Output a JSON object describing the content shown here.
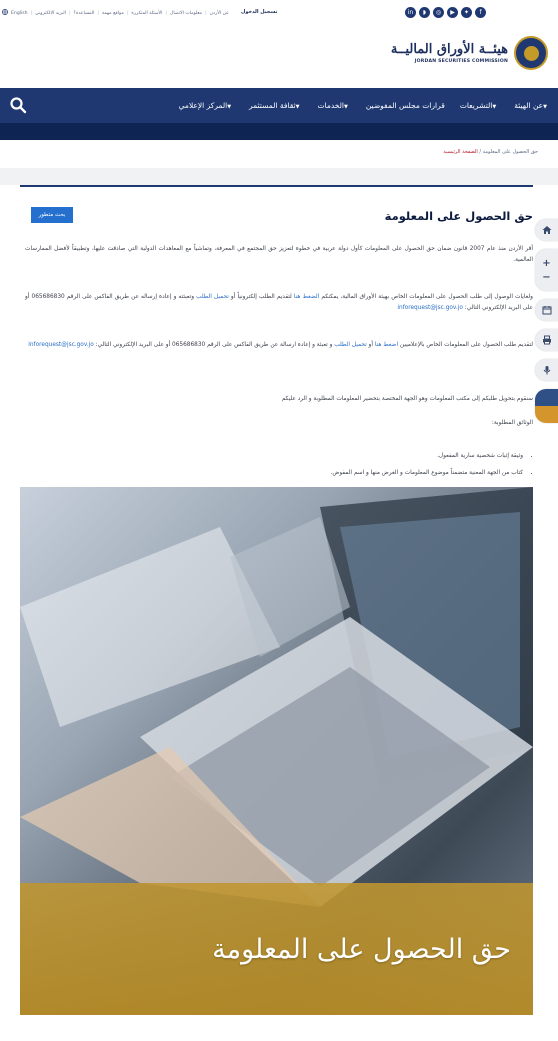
{
  "top_bar": {
    "links": [
      "English",
      "البريد الالكتروني",
      "المساعدة؟",
      "مواقع مهمة",
      "الأسئلة المتكررة",
      "معلومات الاتصال",
      "عن الأردن"
    ],
    "login": "تسجيل الدخول",
    "social_icons": [
      "linkedin-icon",
      "rss-icon",
      "instagram-icon",
      "youtube-icon",
      "twitter-icon",
      "facebook-icon"
    ]
  },
  "logo": {
    "arabic": "هيئــة الأوراق الماليــة",
    "english": "JORDAN SECURITIES COMMISSION"
  },
  "nav": {
    "items": [
      {
        "label": "عن الهيئة",
        "dropdown": true
      },
      {
        "label": "التشريعات",
        "dropdown": true
      },
      {
        "label": "قرارات مجلس المفوضين",
        "dropdown": false
      },
      {
        "label": "الخدمات",
        "dropdown": true
      },
      {
        "label": "ثقافة المستثمر",
        "dropdown": true
      },
      {
        "label": "المركز الإعلامي",
        "dropdown": true
      }
    ]
  },
  "breadcrumb": {
    "home": "الصفحة الرئيسية",
    "separator": "/",
    "current": "حق الحصول على المعلومة"
  },
  "page": {
    "title": "حق الحصول على المعلومة",
    "update_button": "بحث متطور",
    "p1": "أقر الأردن منذ عام 2007 قانون ضمان حق الحصول على المعلومات كأول دولة عربية في خطوة لتعزيز حق المجتمع في المعرفة، وتماشياً مع المعاهدات الدولية التي صادقت عليها، وتطبيقاً لأفضل الممارسات العالمية.",
    "p2_a": "ولغايات الوصول إلى طلب الحصول على المعلومات الخاص بهيئة الأوراق المالية، يمكنكم ",
    "p2_link1": "الضغط هنا",
    "p2_b": " لتقديم الطلب إلكترونياً أو ",
    "p2_link2": "تحميل الطلب",
    "p2_c": " وتعبئته و إعادة إرساله عن طريق الفاكس على الرقم 065686830 أو على البريد الإلكتروني التالي: ",
    "p2_email": "inforequest@jsc.gov.jo",
    "p3_a": "لتقديم طلب الحصول على المعلومات الخاص بالإعلاميين ",
    "p3_link1": "اضغط هنا",
    "p3_b": " أو ",
    "p3_link2": "تحميل الطلب",
    "p3_c": " و تعبئة و إعادة ارسالة عن طريق الفاكس على الرقم 065686830 أو على البريد الإلكتروني التالي: ",
    "p3_email": "inforequest@jsc.gov.jo",
    "p4": "سنقوم بتحويل طلبكم إلى مكتب المعلومات وهو الجهة المختصة بتحضير المعلومات المطلوبة و الرد عليكم",
    "documents_heading": "الوثائق المطلوبة:",
    "documents": [
      "وثيقة إثبات شخصية سارية المفعول.",
      "كتاب من الجهة المعنية متضمناً موضوع المعلومات و الغرض منها و اسم المفوض."
    ],
    "banner_caption": "حق الحصول على المعلومة"
  },
  "sidebar": {
    "icons": [
      "home-icon",
      "zoom-in-icon",
      "zoom-out-icon",
      "calendar-icon",
      "print-icon",
      "microphone-icon",
      "contrast-icon"
    ],
    "zoom_plus": "+",
    "zoom_minus": "−"
  },
  "colors": {
    "brand_navy": "#1f3871",
    "dark_band": "#0e2452",
    "link_blue": "#2b6fc7",
    "button_blue": "#2570cf",
    "gold": "#c49a28",
    "breadcrumb_red": "#b51b2c"
  }
}
